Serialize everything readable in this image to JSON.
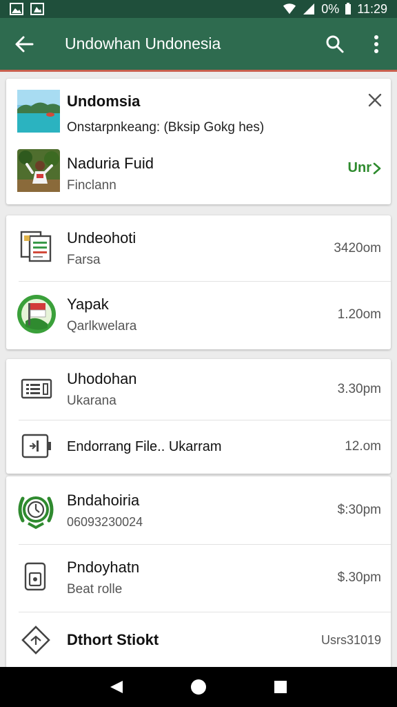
{
  "status_bar": {
    "battery": "0%",
    "time": "11:29"
  },
  "app_bar": {
    "title": "Undowhan Undonesia"
  },
  "featured": {
    "item1": {
      "title": "Undomsia",
      "subtitle": "Onstarpnkeang: (Bksip Gokg hes)"
    },
    "item2": {
      "title": "Naduria Fuid",
      "subtitle": "Finclann",
      "action_label": "Unr",
      "action_color": "#2e8b2e"
    }
  },
  "list": [
    {
      "title": "Undeohoti",
      "subtitle": "Farsa",
      "time": "3420om",
      "icon": "document-icon"
    },
    {
      "title": "Yapak",
      "subtitle": "Qarlkwelara",
      "time": "1.20om",
      "icon": "flag-badge-icon"
    },
    {
      "title": "Uhodohan",
      "subtitle": "Ukarana",
      "time": "3.30pm",
      "icon": "list-box-icon"
    },
    {
      "title": "Endorrang File.. Ukarram",
      "subtitle": "",
      "time": "12.om",
      "icon": "battery-file-icon"
    },
    {
      "title": "Bndahoiria",
      "subtitle": "06093230024",
      "time": "$:30pm",
      "icon": "clock-wreath-icon"
    },
    {
      "title": "Pndoyhatn",
      "subtitle": "Beat rolle",
      "time": "$.30pm",
      "icon": "phone-doc-icon"
    },
    {
      "title": "Dthort Stiokt",
      "subtitle": "",
      "time": "Usrs31019",
      "icon": "diamond-icon"
    }
  ]
}
